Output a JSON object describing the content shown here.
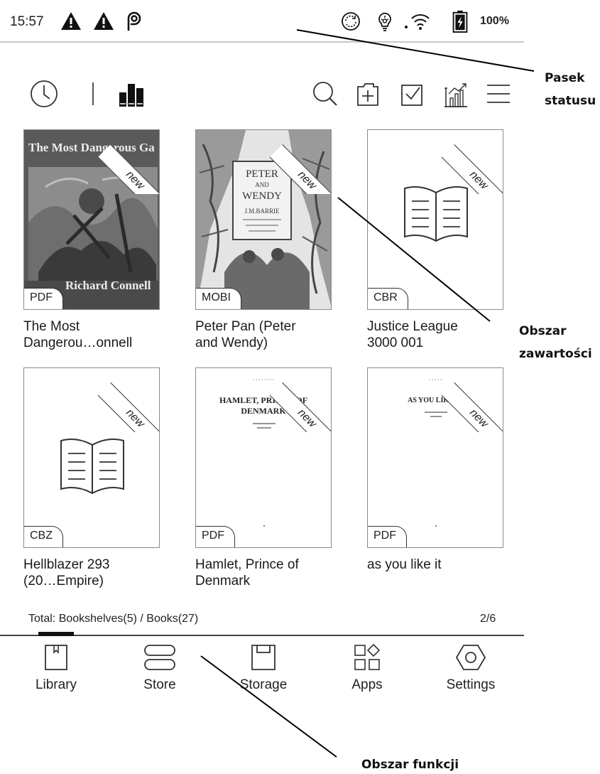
{
  "status_bar": {
    "time": "15:57",
    "icons": [
      "warning-icon",
      "warning-icon",
      "pocket-icon",
      "sync-icon",
      "frontlight-icon",
      "wifi-icon",
      "battery-charging-icon"
    ],
    "battery_percent": "100%"
  },
  "toolbar": {
    "left_icons": [
      "recent-clock-icon",
      "bookshelves-icon"
    ],
    "right_icons": [
      "search-icon",
      "add-folder-icon",
      "select-checkbox-icon",
      "statistics-icon",
      "menu-icon"
    ]
  },
  "books": [
    {
      "title_line1": "The Most",
      "title_line2": "Dangerou…onnell",
      "format": "PDF",
      "new_label": "new",
      "cover": "photo-cover-the-most-dangerous-game"
    },
    {
      "title_line1": "Peter Pan (Peter",
      "title_line2": "and Wendy)",
      "format": "MOBI",
      "new_label": "new",
      "cover": "illustrated-cover-peter-and-wendy"
    },
    {
      "title_line1": "Justice League",
      "title_line2": "3000 001",
      "format": "CBR",
      "new_label": "new",
      "cover": "open-book-icon"
    },
    {
      "title_line1": "Hellblazer 293",
      "title_line2": "(20…Empire)",
      "format": "CBZ",
      "new_label": "new",
      "cover": "open-book-icon"
    },
    {
      "title_line1": "Hamlet, Prince of",
      "title_line2": "Denmark",
      "format": "PDF",
      "new_label": "new",
      "cover": "text-page-cover",
      "cover_text": "HAMLET, PRINCE OF DENMARK"
    },
    {
      "title_line1": "as you like it",
      "title_line2": "",
      "format": "PDF",
      "new_label": "new",
      "cover": "text-page-cover",
      "cover_text": "AS YOU LIKE IT"
    }
  ],
  "cover_art": {
    "most_dangerous_top": "The Most Dangerous Ga",
    "most_dangerous_bottom": "Richard Connell",
    "peter_line1": "PETER",
    "peter_line2": "AND",
    "peter_line3": "WENDY",
    "peter_author": "J.M.BARRIE"
  },
  "footer": {
    "total": "Total: Bookshelves(5) / Books(27)",
    "page": "2/6"
  },
  "nav": [
    {
      "label": "Library",
      "icon": "library-icon",
      "active": true
    },
    {
      "label": "Store",
      "icon": "store-icon",
      "active": false
    },
    {
      "label": "Storage",
      "icon": "storage-icon",
      "active": false
    },
    {
      "label": "Apps",
      "icon": "apps-icon",
      "active": false
    },
    {
      "label": "Settings",
      "icon": "settings-icon",
      "active": false
    }
  ],
  "annotations": {
    "status_line1": "Pasek",
    "status_line2": "statusu",
    "content_line1": "Obszar",
    "content_line2": "zawartości",
    "function": "Obszar funkcji"
  }
}
